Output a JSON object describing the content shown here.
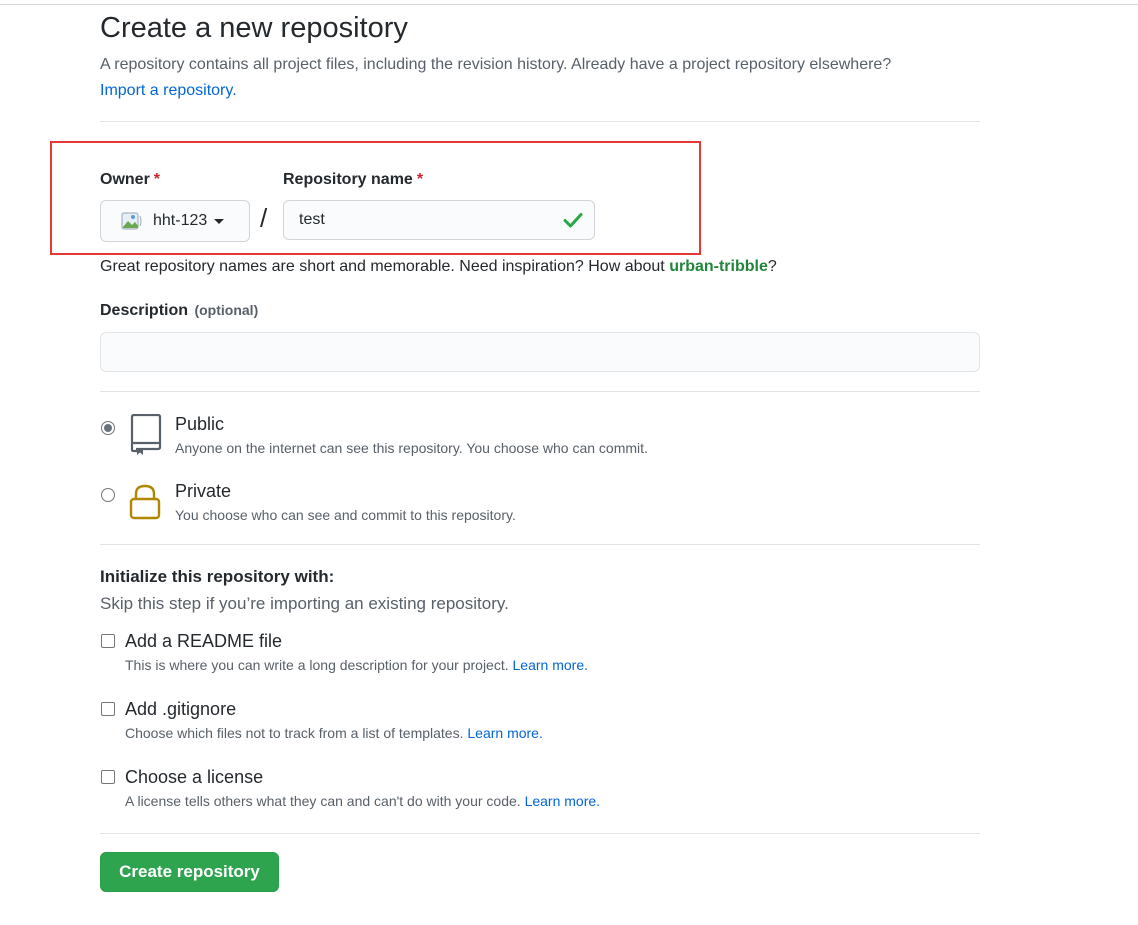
{
  "header": {
    "title": "Create a new repository",
    "description": "A repository contains all project files, including the revision history. Already have a project repository elsewhere?",
    "import_link": "Import a repository."
  },
  "owner": {
    "label": "Owner",
    "required_mark": "*",
    "value": "hht-123",
    "avatar_icon": "avatar-icon"
  },
  "separator": "/",
  "repo_name": {
    "label": "Repository name",
    "required_mark": "*",
    "value": "test",
    "status_icon": "check-icon"
  },
  "name_hint": {
    "text": "Great repository names are short and memorable. Need inspiration? How about ",
    "suggestion": "urban-tribble",
    "suffix": "?"
  },
  "description": {
    "label": "Description",
    "optional": "(optional)",
    "value": ""
  },
  "visibility": {
    "options": [
      {
        "title": "Public",
        "desc": "Anyone on the internet can see this repository. You choose who can commit.",
        "selected": true,
        "icon": "repo-book-icon"
      },
      {
        "title": "Private",
        "desc": "You choose who can see and commit to this repository.",
        "selected": false,
        "icon": "lock-icon"
      }
    ]
  },
  "initialize": {
    "title": "Initialize this repository with:",
    "subtitle": "Skip this step if you’re importing an existing repository.",
    "options": [
      {
        "title": "Add a README file",
        "desc": "This is where you can write a long description for your project.",
        "link": "Learn more."
      },
      {
        "title": "Add .gitignore",
        "desc": "Choose which files not to track from a list of templates.",
        "link": "Learn more."
      },
      {
        "title": "Choose a license",
        "desc": "A license tells others what they can and can't do with your code.",
        "link": "Learn more."
      }
    ]
  },
  "submit": {
    "label": "Create repository"
  },
  "colors": {
    "primary_button": "#2ea44f",
    "link": "#0366d6",
    "suggestion": "#22863a",
    "required": "#cb2431",
    "highlight_box": "#e53935",
    "lock_icon": "#b08800"
  }
}
